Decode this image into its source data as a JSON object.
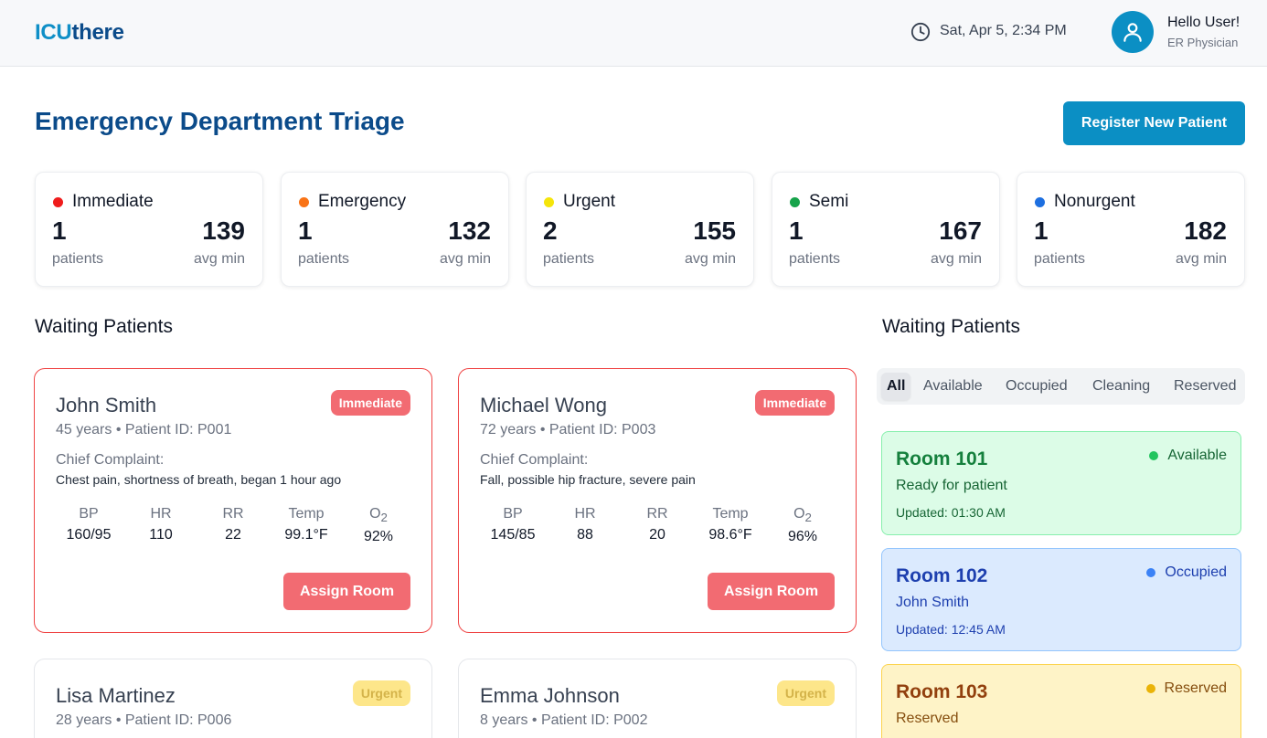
{
  "header": {
    "logo_part1": "ICU",
    "logo_part2": "there",
    "datetime": "Sat, Apr 5, 2:34 PM",
    "greeting": "Hello User!",
    "role": "ER Physician"
  },
  "page": {
    "title": "Emergency Department Triage",
    "register_label": "Register New Patient"
  },
  "stats": [
    {
      "label": "Immediate",
      "count": "1",
      "count_caption": "patients",
      "avg": "139",
      "avg_caption": "avg min",
      "color": "#ef1c1c"
    },
    {
      "label": "Emergency",
      "count": "1",
      "count_caption": "patients",
      "avg": "132",
      "avg_caption": "avg min",
      "color": "#f97316"
    },
    {
      "label": "Urgent",
      "count": "2",
      "count_caption": "patients",
      "avg": "155",
      "avg_caption": "avg min",
      "color": "#f5e50a"
    },
    {
      "label": "Semi",
      "count": "1",
      "count_caption": "patients",
      "avg": "167",
      "avg_caption": "avg min",
      "color": "#16a34a"
    },
    {
      "label": "Nonurgent",
      "count": "1",
      "count_caption": "patients",
      "avg": "182",
      "avg_caption": "avg min",
      "color": "#1d6fe0"
    }
  ],
  "waiting_title": "Waiting Patients",
  "rooms_title": "Waiting Patients",
  "vital_labels": {
    "bp": "BP",
    "hr": "HR",
    "rr": "RR",
    "temp": "Temp",
    "o2_main": "O",
    "o2_sub": "2"
  },
  "patients": [
    {
      "name": "John Smith",
      "meta": "45 years • Patient ID: P001",
      "badge": "Immediate",
      "cc_label": "Chief Complaint:",
      "complaint": "Chest pain, shortness of breath, began 1 hour ago",
      "bp": "160/95",
      "hr": "110",
      "rr": "22",
      "temp": "99.1°F",
      "o2": "92%",
      "action": "Assign Room"
    },
    {
      "name": "Michael Wong",
      "meta": "72 years • Patient ID: P003",
      "badge": "Immediate",
      "cc_label": "Chief Complaint:",
      "complaint": "Fall, possible hip fracture, severe pain",
      "bp": "145/85",
      "hr": "88",
      "rr": "20",
      "temp": "98.6°F",
      "o2": "96%",
      "action": "Assign Room"
    },
    {
      "name": "Lisa Martinez",
      "meta": "28 years • Patient ID: P006",
      "badge": "Urgent"
    },
    {
      "name": "Emma Johnson",
      "meta": "8 years • Patient ID: P002",
      "badge": "Urgent"
    }
  ],
  "filters": [
    "All",
    "Available",
    "Occupied",
    "Cleaning",
    "Reserved"
  ],
  "rooms": [
    {
      "name": "Room 101",
      "status": "Available",
      "sub": "Ready for patient",
      "updated": "Updated: 01:30 AM",
      "dot": "#22c55e"
    },
    {
      "name": "Room 102",
      "status": "Occupied",
      "sub": "John Smith",
      "updated": "Updated: 12:45 AM",
      "dot": "#3b82f6"
    },
    {
      "name": "Room 103",
      "status": "Reserved",
      "sub": "Reserved",
      "dot": "#eab308"
    }
  ]
}
